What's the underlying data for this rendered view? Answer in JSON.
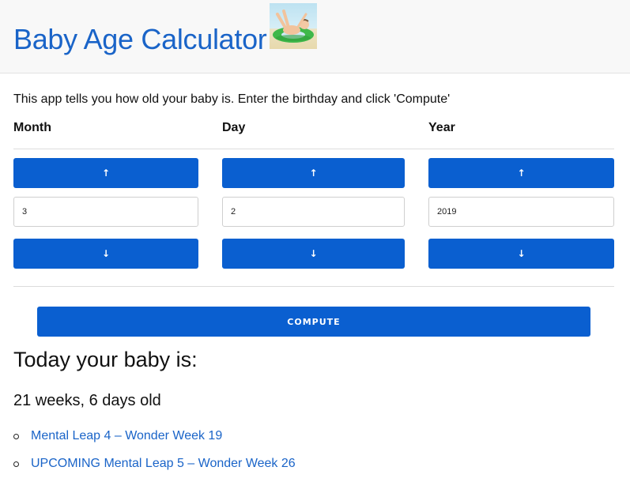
{
  "header": {
    "title": "Baby Age Calculator",
    "logo_icon": "baby-in-float-ring-image"
  },
  "intro": "This app tells you how old your baby is. Enter the birthday and click 'Compute'",
  "inputs": {
    "month": {
      "label": "Month",
      "value": "3"
    },
    "day": {
      "label": "Day",
      "value": "2"
    },
    "year": {
      "label": "Year",
      "value": "2019"
    }
  },
  "controls": {
    "up_arrow": "↑",
    "down_arrow": "↓",
    "compute_label": "COMPUTE"
  },
  "result": {
    "heading": "Today your baby is:",
    "age": "21 weeks, 6 days old"
  },
  "leaps": [
    {
      "label": "Mental Leap 4 – Wonder Week 19"
    },
    {
      "label": "UPCOMING Mental Leap 5 – Wonder Week 26"
    }
  ],
  "colors": {
    "accent": "#0a5fd0",
    "link": "#1a64c8",
    "header_bg": "#f8f8f8"
  }
}
